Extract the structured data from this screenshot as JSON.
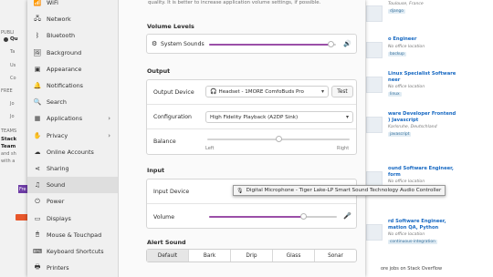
{
  "background_left": {
    "items": [
      "PUBLI",
      "Qu",
      "Ta",
      "Us",
      "Co",
      "Co",
      "FREE",
      "Jo",
      "Jo",
      "TEAMS",
      "Stack",
      "Team",
      "and sh",
      "with a",
      "Fre"
    ]
  },
  "background_right": {
    "jobs": [
      {
        "title": "",
        "location": "Toulouse, France",
        "tag": "django"
      },
      {
        "title": "o Engineer",
        "location": "No office location",
        "tag": "backup"
      },
      {
        "title": "Linux Specialist Software\nneer",
        "location": "No office location",
        "tag": "linux"
      },
      {
        "title": "ware Developer Frontend\n) Javascript",
        "location": "Karlsruhe, Deutschland",
        "tag": "javascript"
      },
      {
        "title": "ound Software Engineer,\nform",
        "location": "No office location",
        "tag": "amazon-web-services"
      },
      {
        "title": "rd Software Engineer,\nmation QA, Python",
        "location": "No office location",
        "tag": "continuous-integration"
      }
    ],
    "footer": "ore jobs on Stack Overflow"
  },
  "sidebar": {
    "items": [
      {
        "icon": "wifi-icon",
        "glyph": "📶",
        "label": "WiFi"
      },
      {
        "icon": "network-icon",
        "glyph": "🖧",
        "label": "Network"
      },
      {
        "icon": "bluetooth-icon",
        "glyph": "ᛒ",
        "label": "Bluetooth"
      },
      {
        "icon": "background-icon",
        "glyph": "🖼",
        "label": "Background"
      },
      {
        "icon": "appearance-icon",
        "glyph": "▣",
        "label": "Appearance"
      },
      {
        "icon": "notifications-icon",
        "glyph": "🔔",
        "label": "Notifications"
      },
      {
        "icon": "search-icon",
        "glyph": "🔍",
        "label": "Search"
      },
      {
        "icon": "applications-icon",
        "glyph": "▦",
        "label": "Applications",
        "chevron": "›"
      },
      {
        "icon": "privacy-icon",
        "glyph": "✋",
        "label": "Privacy",
        "chevron": "›"
      },
      {
        "icon": "online-accounts-icon",
        "glyph": "☁",
        "label": "Online Accounts"
      },
      {
        "icon": "sharing-icon",
        "glyph": "⋖",
        "label": "Sharing"
      },
      {
        "icon": "sound-icon",
        "glyph": "♫",
        "label": "Sound"
      },
      {
        "icon": "power-icon",
        "glyph": "⏻",
        "label": "Power"
      },
      {
        "icon": "displays-icon",
        "glyph": "▭",
        "label": "Displays"
      },
      {
        "icon": "mouse-touchpad-icon",
        "glyph": "🖱",
        "label": "Mouse & Touchpad"
      },
      {
        "icon": "keyboard-icon",
        "glyph": "⌨",
        "label": "Keyboard Shortcuts"
      },
      {
        "icon": "printers-icon",
        "glyph": "🖶",
        "label": "Printers"
      }
    ],
    "active_index": 11
  },
  "sound": {
    "hint": "quality. It is better to increase application volume settings, if possible.",
    "volume_levels": {
      "heading": "Volume Levels",
      "system_sounds_label": "System Sounds",
      "system_sounds_level": 0.96
    },
    "output": {
      "heading": "Output",
      "device_label": "Output Device",
      "device_value": "Headset - 1MORE ComfoBuds Pro",
      "test_label": "Test",
      "configuration_label": "Configuration",
      "configuration_value": "High Fidelity Playback (A2DP Sink)",
      "balance_label": "Balance",
      "balance_left": "Left",
      "balance_right": "Right",
      "balance_value": 0.5
    },
    "input": {
      "heading": "Input",
      "device_label": "Input Device",
      "device_tooltip": "Digital Microphone - Tiger Lake-LP Smart Sound Technology Audio Controller",
      "volume_label": "Volume",
      "volume_level": 0.74
    },
    "alert_sound": {
      "heading": "Alert Sound",
      "options": [
        "Default",
        "Bark",
        "Drip",
        "Glass",
        "Sonar"
      ],
      "selected": "Default"
    }
  },
  "colors": {
    "accent": "#9b4fa8",
    "link": "#1668c2",
    "orange": "#e8572b"
  }
}
